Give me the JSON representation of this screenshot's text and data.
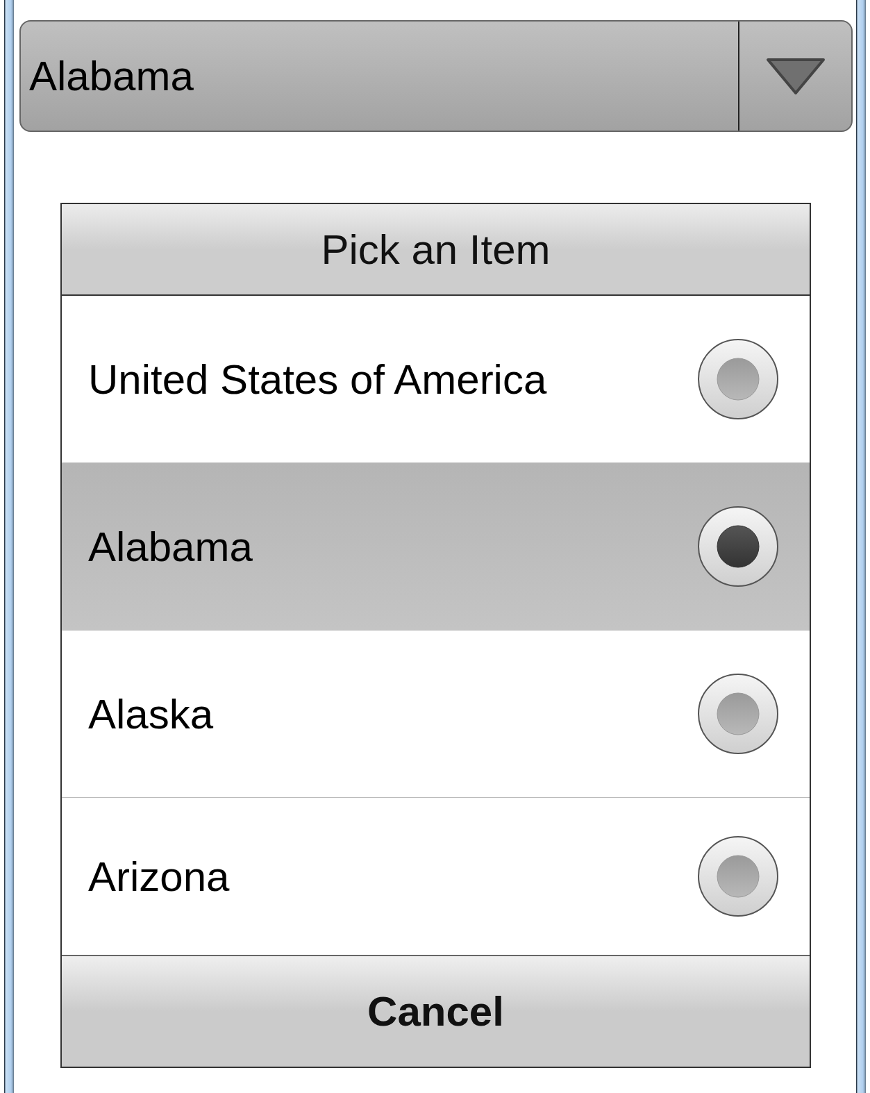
{
  "dropdown": {
    "value": "Alabama",
    "expanded": true
  },
  "dialog": {
    "title": "Pick an Item",
    "items": [
      {
        "label": "United States of America",
        "selected": false
      },
      {
        "label": "Alabama",
        "selected": true
      },
      {
        "label": "Alaska",
        "selected": false
      },
      {
        "label": "Arizona",
        "selected": false
      }
    ],
    "cancel": "Cancel"
  }
}
